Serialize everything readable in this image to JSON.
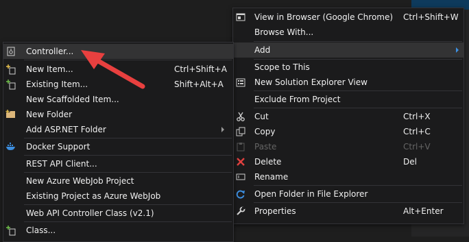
{
  "left_menu": {
    "items": [
      {
        "label": "Controller...",
        "shortcut": "",
        "icon": "controller-icon"
      },
      {
        "label": "New Item...",
        "shortcut": "Ctrl+Shift+A",
        "icon": "new-item-icon"
      },
      {
        "label": "Existing Item...",
        "shortcut": "Shift+Alt+A",
        "icon": "existing-item-icon"
      },
      {
        "label": "New Scaffolded Item...",
        "shortcut": "",
        "icon": ""
      },
      {
        "label": "New Folder",
        "shortcut": "",
        "icon": "folder-icon"
      },
      {
        "label": "Add ASP.NET Folder",
        "shortcut": "",
        "icon": "",
        "submenu": true
      },
      {
        "label": "Docker Support",
        "shortcut": "",
        "icon": "docker-icon"
      },
      {
        "label": "REST API Client...",
        "shortcut": "",
        "icon": ""
      },
      {
        "label": "New Azure WebJob Project",
        "shortcut": "",
        "icon": ""
      },
      {
        "label": "Existing Project as Azure WebJob",
        "shortcut": "",
        "icon": ""
      },
      {
        "label": "Web API Controller Class (v2.1)",
        "shortcut": "",
        "icon": ""
      },
      {
        "label": "Class...",
        "shortcut": "",
        "icon": "class-icon"
      }
    ]
  },
  "right_menu": {
    "items": [
      {
        "label": "View in Browser (Google Chrome)",
        "shortcut": "Ctrl+Shift+W",
        "icon": "browser-icon"
      },
      {
        "label": "Browse With...",
        "shortcut": "",
        "icon": ""
      },
      {
        "label": "Add",
        "shortcut": "",
        "icon": "",
        "submenu": true
      },
      {
        "label": "Scope to This",
        "shortcut": "",
        "icon": ""
      },
      {
        "label": "New Solution Explorer View",
        "shortcut": "",
        "icon": "solution-explorer-icon"
      },
      {
        "label": "Exclude From Project",
        "shortcut": "",
        "icon": ""
      },
      {
        "label": "Cut",
        "shortcut": "Ctrl+X",
        "icon": "scissors-icon"
      },
      {
        "label": "Copy",
        "shortcut": "Ctrl+C",
        "icon": "copy-icon"
      },
      {
        "label": "Paste",
        "shortcut": "Ctrl+V",
        "icon": "paste-icon",
        "disabled": true
      },
      {
        "label": "Delete",
        "shortcut": "Del",
        "icon": "delete-icon"
      },
      {
        "label": "Rename",
        "shortcut": "",
        "icon": "rename-icon"
      },
      {
        "label": "Open Folder in File Explorer",
        "shortcut": "",
        "icon": "refresh-icon"
      },
      {
        "label": "Properties",
        "shortcut": "Alt+Enter",
        "icon": "wrench-icon"
      }
    ]
  },
  "colors": {
    "menu_bg": "#1b1b1c",
    "hover_bg": "#333334",
    "text": "#f1f1f1",
    "disabled_text": "#656565",
    "callout_red": "#e8403f",
    "submenu_arrow_blue": "#3d8fe0"
  }
}
